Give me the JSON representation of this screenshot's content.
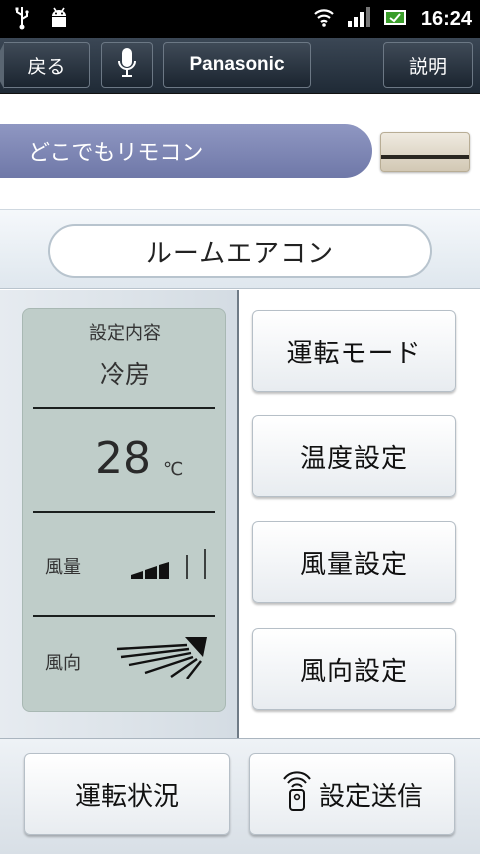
{
  "status_bar": {
    "time": "16:24",
    "icons": [
      "usb-icon",
      "android-debug-icon",
      "wifi-icon",
      "signal-icon",
      "battery-icon"
    ]
  },
  "toolbar": {
    "back_label": "戻る",
    "mic_icon": "microphone-icon",
    "brand_label": "Panasonic",
    "help_label": "説明"
  },
  "app_title": "どこでもリモコン",
  "device_icon": "air-conditioner-icon",
  "room_label": "ルームエアコン",
  "display": {
    "caption": "設定内容",
    "mode": "冷房",
    "temperature": "28",
    "temperature_unit": "℃",
    "fan_label": "風量",
    "fan_level": 0.5,
    "direction_label": "風向",
    "direction_icon": "airflow-direction-icon"
  },
  "buttons": {
    "mode": "運転モード",
    "temperature": "温度設定",
    "fan": "風量設定",
    "direction": "風向設定"
  },
  "bottom": {
    "status": "運転状況",
    "send": "設定送信",
    "send_icon": "remote-signal-icon"
  },
  "colors": {
    "toolbar": "#2b3642",
    "title_band": "#7c85b4",
    "lcd": "#bfcdc9"
  }
}
